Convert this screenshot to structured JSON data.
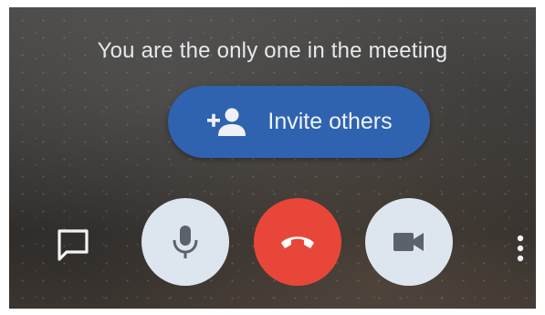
{
  "meeting": {
    "status_message": "You are the only one in the meeting"
  },
  "invite_button": {
    "label": "Invite others",
    "icon": "person-add-icon"
  },
  "controls": {
    "chat_icon": "chat-icon",
    "mic_icon": "mic-icon",
    "end_call_icon": "end-call-icon",
    "camera_icon": "video-camera-icon",
    "more_icon": "more-vert-icon"
  },
  "colors": {
    "invite_button": "#2f63b0",
    "end_call": "#e9463a",
    "control_button": "#dde5ee",
    "icon_dark": "#5b626a",
    "text_light": "#e6e8ea"
  }
}
